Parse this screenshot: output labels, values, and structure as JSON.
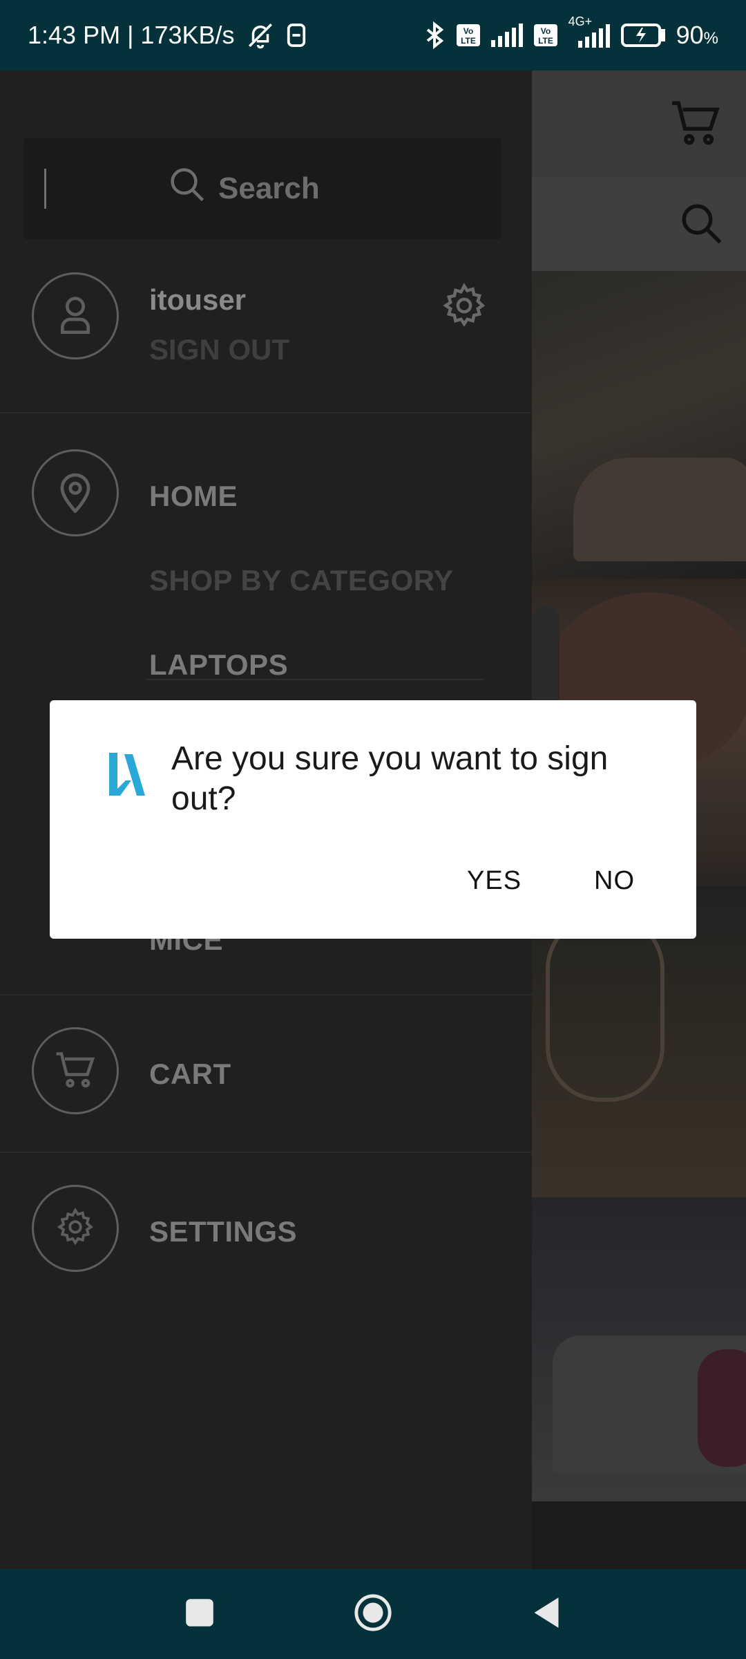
{
  "status_bar": {
    "time_speed": "1:43 PM | 173KB/s",
    "net_type": "4G+",
    "battery": "90",
    "battery_unit": "%"
  },
  "drawer": {
    "search_placeholder": "Search",
    "username": "itouser",
    "sign_out": "SIGN OUT",
    "home": "HOME",
    "shop_by_category": "SHOP BY CATEGORY",
    "laptops": "LAPTOPS",
    "mice": "MICE",
    "cart": "CART",
    "settings": "SETTINGS"
  },
  "dialog": {
    "message": "Are you sure you want to sign out?",
    "yes": "YES",
    "no": "NO",
    "accent_color": "#2aa8d8"
  },
  "icons": {
    "drawer_search": "search-icon",
    "profile": "user-icon",
    "gear": "gear-icon",
    "home": "map-pin-icon",
    "cart": "cart-icon",
    "settings": "gear-icon",
    "app_header_cart": "cart-icon",
    "app_header_search": "search-icon"
  }
}
